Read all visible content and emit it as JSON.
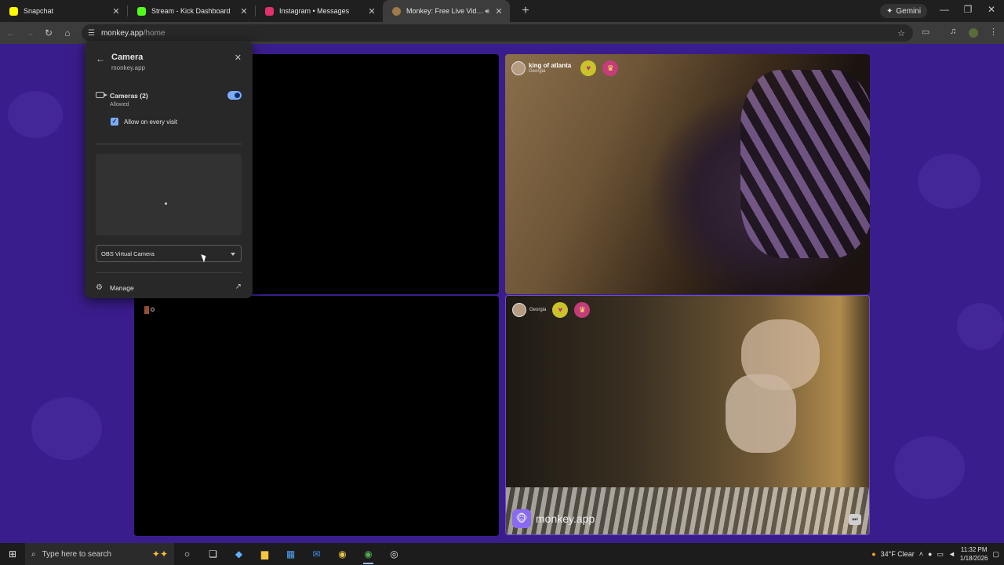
{
  "browser": {
    "tabs": [
      {
        "title": "Snapchat",
        "color": "#fffc00"
      },
      {
        "title": "Stream - Kick Dashboard",
        "color": "#53fc18"
      },
      {
        "title": "Instagram • Messages",
        "color": "#e1306c"
      },
      {
        "title": "Monkey: Free Live Video Ch",
        "color": "#a07a4a",
        "active": true
      }
    ],
    "gemini_label": "Gemini",
    "url_host": "monkey.app",
    "url_path": "/home"
  },
  "popup": {
    "title": "Camera",
    "site": "monkey.app",
    "camera_label": "Cameras (2)",
    "camera_status": "Allowed",
    "toggle_on": true,
    "checkbox_label": "Allow on every visit",
    "checkbox_checked": true,
    "selected_camera": "OBS Virtual Camera",
    "manage_label": "Manage"
  },
  "video": {
    "user1": {
      "name": "king of atlanta",
      "location": "Georgia"
    },
    "user2": {
      "name": "",
      "location": "Georgia"
    },
    "watermark": "monkey.app"
  },
  "taskbar": {
    "search_placeholder": "Type here to search",
    "weather": "34°F  Clear",
    "time": "11:32 PM",
    "date": "1/18/2026"
  }
}
